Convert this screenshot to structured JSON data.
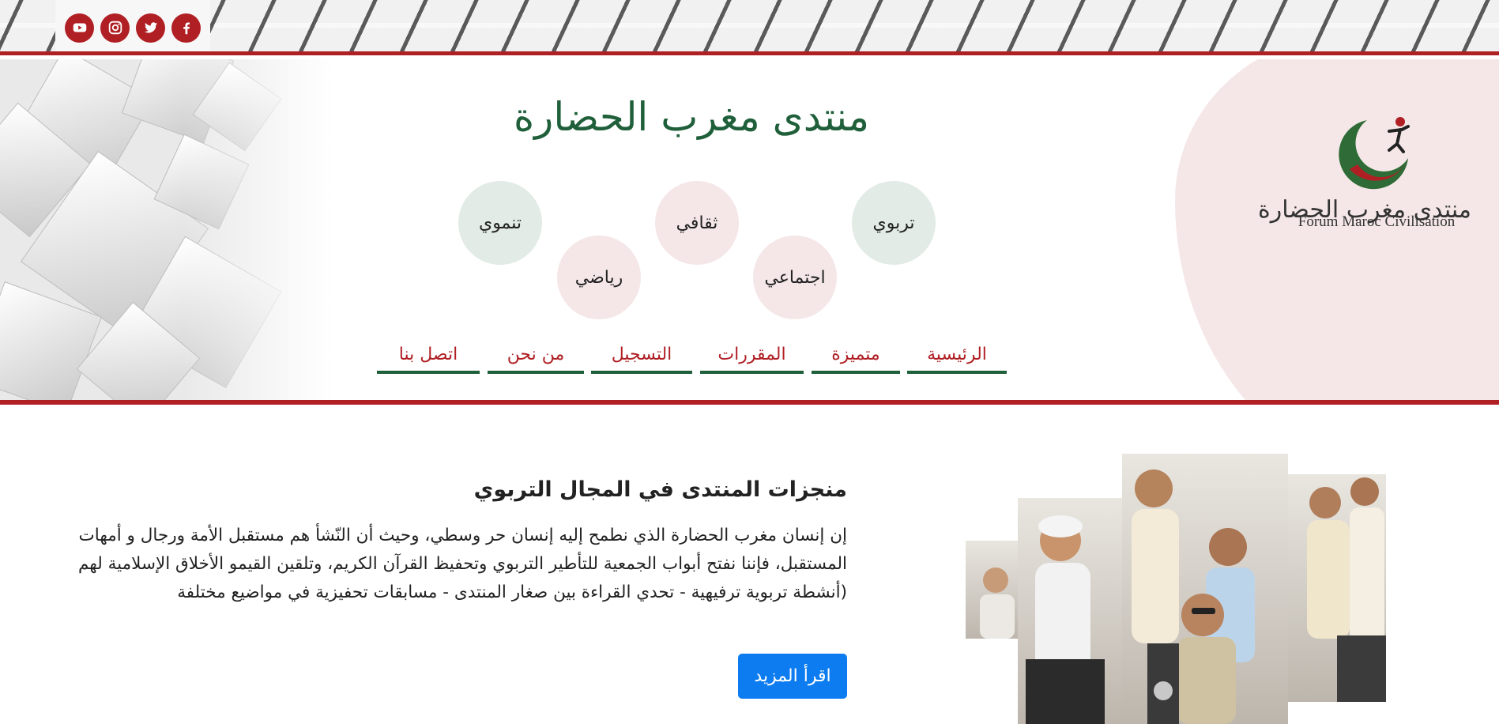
{
  "social": {
    "items": [
      {
        "name": "youtube-icon"
      },
      {
        "name": "instagram-icon"
      },
      {
        "name": "twitter-icon"
      },
      {
        "name": "facebook-icon"
      }
    ],
    "accent_color": "#b01f24"
  },
  "brand": {
    "logo_ar": "منتدى مغرب الحضارة",
    "logo_en": "Forum Maroc Civilisation",
    "site_title": "منتدى مغرب الحضارة",
    "title_color": "#1f5f3a"
  },
  "categories": [
    {
      "label": "تربوي",
      "color": "#e2ebe6"
    },
    {
      "label": "اجتماعي",
      "color": "#f5e7e7"
    },
    {
      "label": "ثقافي",
      "color": "#f5e7e7"
    },
    {
      "label": "رياضي",
      "color": "#f5e7e7"
    },
    {
      "label": "تنموي",
      "color": "#e2ebe6"
    }
  ],
  "nav": {
    "items": [
      {
        "label": "الرئيسية"
      },
      {
        "label": "متميزة"
      },
      {
        "label": "المقررات"
      },
      {
        "label": "التسجيل"
      },
      {
        "label": "من نحن"
      },
      {
        "label": "اتصل بنا"
      }
    ],
    "text_color": "#b01f24",
    "underline_color": "#1f5f3a"
  },
  "section": {
    "title": "منجزات المنتدى في المجال التربوي",
    "body": "إن إنسان مغرب الحضارة الذي نطمح إليه إنسان حر وسطي، وحيث أن النّشأ هم مستقبل الأمة ورجال و أمهات المستقبل، فإننا نفتح أبواب الجمعية للتأطير التربوي وتحفيظ القرآن الكريم، وتلقين القيمو الأخلاق الإسلامية لهم (أنشطة تربوية ترفيهية - تحدي القراءة بين صغار المنتدى - مسابقات تحفيزية في مواضيع مختلفة",
    "button_label": "اقرأ المزيد",
    "button_color": "#0d7cf0"
  }
}
